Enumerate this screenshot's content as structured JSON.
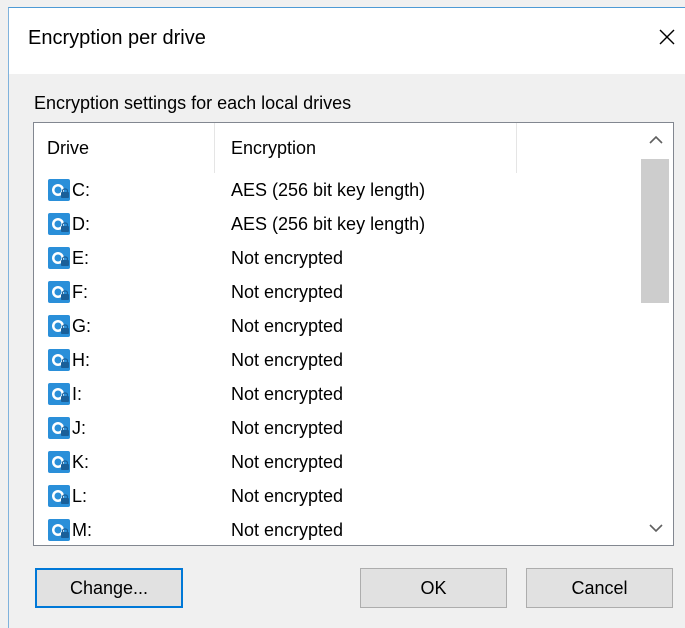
{
  "dialog": {
    "title": "Encryption per drive",
    "group_label": "Encryption settings for each local drives",
    "close_icon": "close-icon"
  },
  "list": {
    "columns": [
      "Drive",
      "Encryption"
    ],
    "rows": [
      {
        "drive": "C:",
        "encryption": "AES (256 bit key length)",
        "icon": "drive-icon"
      },
      {
        "drive": "D:",
        "encryption": "AES (256 bit key length)",
        "icon": "drive-icon"
      },
      {
        "drive": "E:",
        "encryption": "Not encrypted",
        "icon": "drive-icon"
      },
      {
        "drive": "F:",
        "encryption": "Not encrypted",
        "icon": "drive-icon"
      },
      {
        "drive": "G:",
        "encryption": "Not encrypted",
        "icon": "drive-icon"
      },
      {
        "drive": "H:",
        "encryption": "Not encrypted",
        "icon": "drive-icon"
      },
      {
        "drive": "I:",
        "encryption": "Not encrypted",
        "icon": "drive-icon"
      },
      {
        "drive": "J:",
        "encryption": "Not encrypted",
        "icon": "drive-icon"
      },
      {
        "drive": "K:",
        "encryption": "Not encrypted",
        "icon": "drive-icon"
      },
      {
        "drive": "L:",
        "encryption": "Not encrypted",
        "icon": "drive-icon"
      },
      {
        "drive": "M:",
        "encryption": "Not encrypted",
        "icon": "drive-icon"
      }
    ],
    "scroll_up_icon": "chevron-up-icon",
    "scroll_down_icon": "chevron-down-icon"
  },
  "buttons": {
    "change": "Change...",
    "ok": "OK",
    "cancel": "Cancel"
  },
  "colors": {
    "dialog_bg": "#f0f0f0",
    "accent": "#0078d7",
    "drive_icon": "#2a8fd9"
  }
}
